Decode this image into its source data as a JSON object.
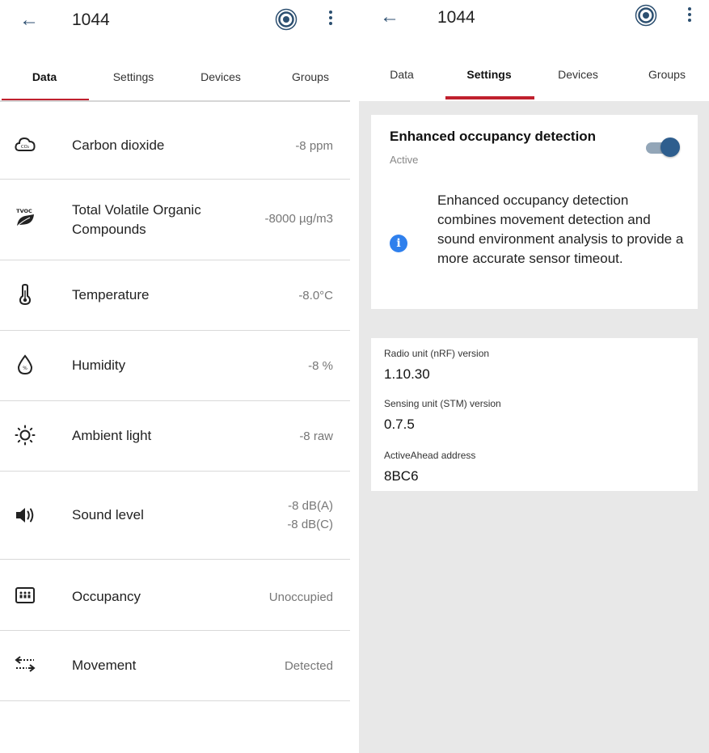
{
  "left": {
    "title": "1044",
    "tabs": [
      {
        "label": "Data"
      },
      {
        "label": "Settings"
      },
      {
        "label": "Devices"
      },
      {
        "label": "Groups"
      }
    ],
    "active_tab": "Data",
    "rows": [
      {
        "label": "Carbon dioxide",
        "value": "-8 ppm",
        "icon": "co2-cloud-icon"
      },
      {
        "label": "Total Volatile Organic Compounds",
        "value": "-8000 µg/m3",
        "icon": "tvoc-leaf-icon",
        "icon_text": "TVOC"
      },
      {
        "label": "Temperature",
        "value": "-8.0°C",
        "icon": "thermometer-icon"
      },
      {
        "label": "Humidity",
        "value": "-8 %",
        "icon": "humidity-drop-icon"
      },
      {
        "label": "Ambient light",
        "value": "-8 raw",
        "icon": "sun-icon"
      },
      {
        "label": "Sound level",
        "value": "-8 dB(A)",
        "value2": "-8 dB(C)",
        "icon": "speaker-icon"
      },
      {
        "label": "Occupancy",
        "value": "Unoccupied",
        "icon": "occupancy-icon"
      },
      {
        "label": "Movement",
        "value": "Detected",
        "icon": "movement-arrows-icon"
      }
    ]
  },
  "right": {
    "title": "1044",
    "tabs": [
      {
        "label": "Data"
      },
      {
        "label": "Settings"
      },
      {
        "label": "Devices"
      },
      {
        "label": "Groups"
      }
    ],
    "active_tab": "Settings",
    "occupancy_card": {
      "title": "Enhanced occupancy detection",
      "status": "Active",
      "toggle_on": true,
      "info": "Enhanced occupancy detection combines movement detection and sound environment analysis to provide a more accurate sensor timeout."
    },
    "info_card": {
      "items": [
        {
          "label": "Radio unit (nRF) version",
          "value": "1.10.30"
        },
        {
          "label": "Sensing unit (STM) version",
          "value": "0.7.5"
        },
        {
          "label": "ActiveAhead address",
          "value": "8BC6"
        }
      ]
    }
  },
  "colors": {
    "accent": "#c0202e",
    "icon_primary": "#2c4f70",
    "toggle": "#2e5e8e",
    "info": "#2f80ed"
  }
}
